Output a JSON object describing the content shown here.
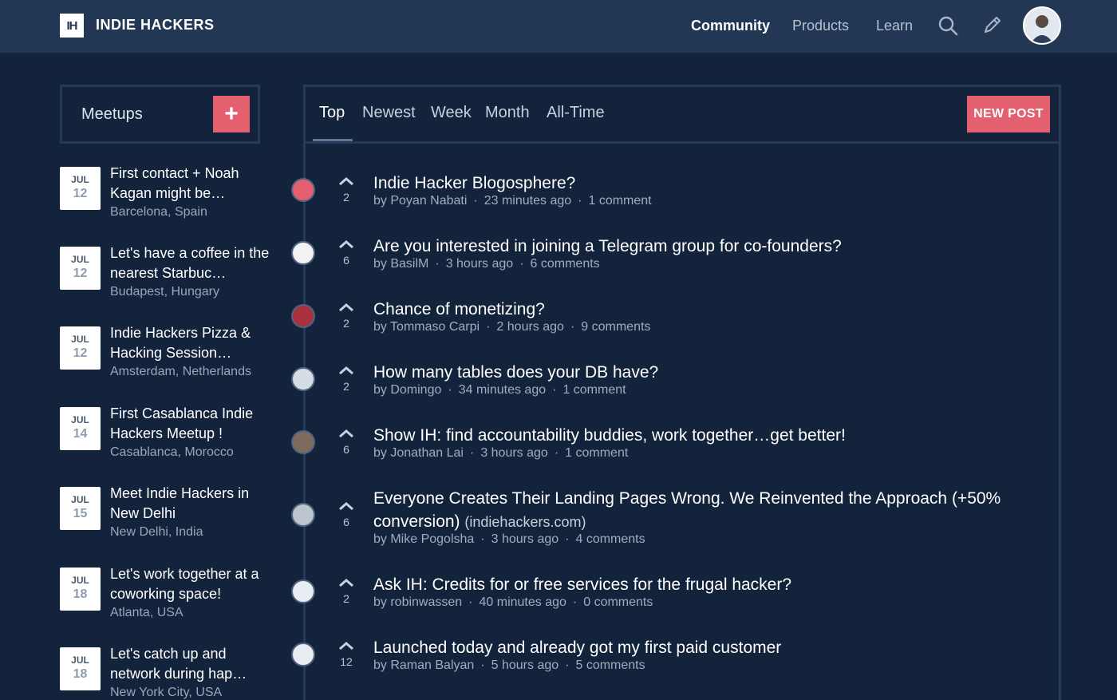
{
  "header": {
    "logo_text": "IH",
    "brand": "INDIE HACKERS",
    "nav": [
      "Community",
      "Products",
      "Learn"
    ],
    "active_nav": "Community",
    "icons": [
      "search-icon",
      "pencil-icon",
      "user-avatar"
    ]
  },
  "sidebar": {
    "title": "Meetups",
    "add_label": "+",
    "meetups": [
      {
        "month": "JUL",
        "day": "12",
        "title": "First contact + Noah Kagan might be…",
        "location": "Barcelona, Spain"
      },
      {
        "month": "JUL",
        "day": "12",
        "title": "Let's have a coffee in the nearest Starbuc…",
        "location": "Budapest, Hungary"
      },
      {
        "month": "JUL",
        "day": "12",
        "title": "Indie Hackers Pizza & Hacking Session…",
        "location": "Amsterdam, Netherlands"
      },
      {
        "month": "JUL",
        "day": "14",
        "title": "First Casablanca Indie Hackers Meetup !",
        "location": "Casablanca, Morocco"
      },
      {
        "month": "JUL",
        "day": "15",
        "title": "Meet Indie Hackers in New Delhi",
        "location": "New Delhi, India"
      },
      {
        "month": "JUL",
        "day": "18",
        "title": "Let's work together at a coworking space!",
        "location": "Atlanta, USA"
      },
      {
        "month": "JUL",
        "day": "18",
        "title": "Let's catch up and network during hap…",
        "location": "New York City, USA"
      }
    ]
  },
  "tabs": {
    "items": [
      "Top",
      "Newest",
      "Week",
      "Month",
      "All-Time"
    ],
    "active": "Top",
    "new_post_label": "NEW POST"
  },
  "posts": [
    {
      "votes": "2",
      "title": "Indie Hacker Blogosphere?",
      "domain": "",
      "author": "by Poyan Nabati",
      "time": "23 minutes ago",
      "comments": "1 comment"
    },
    {
      "votes": "6",
      "title": "Are you interested in joining a Telegram group for co-founders?",
      "domain": "",
      "author": "by BasilM",
      "time": "3 hours ago",
      "comments": "6 comments"
    },
    {
      "votes": "2",
      "title": "Chance of monetizing?",
      "domain": "",
      "author": "by Tommaso Carpi",
      "time": "2 hours ago",
      "comments": "9 comments"
    },
    {
      "votes": "2",
      "title": "How many tables does your DB have?",
      "domain": "",
      "author": "by Domingo",
      "time": "34 minutes ago",
      "comments": "1 comment"
    },
    {
      "votes": "6",
      "title": "Show IH: find accountability buddies, work together…get better!",
      "domain": "",
      "author": "by Jonathan Lai",
      "time": "3 hours ago",
      "comments": "1 comment"
    },
    {
      "votes": "6",
      "title": "Everyone Creates Their Landing Pages Wrong. We Reinvented the Approach (+50% conversion)",
      "domain": "(indiehackers.com)",
      "author": "by Mike Pogolsha",
      "time": "3 hours ago",
      "comments": "4 comments"
    },
    {
      "votes": "2",
      "title": "Ask IH: Credits for or free services for the frugal hacker?",
      "domain": "",
      "author": "by robinwassen",
      "time": "40 minutes ago",
      "comments": "0 comments"
    },
    {
      "votes": "12",
      "title": "Launched today and already got my first paid customer",
      "domain": "",
      "author": "by Raman Balyan",
      "time": "5 hours ago",
      "comments": "5 comments"
    }
  ],
  "colors": {
    "background": "#13233b",
    "header": "#223754",
    "accent": "#e4606f",
    "border": "#243a58"
  }
}
